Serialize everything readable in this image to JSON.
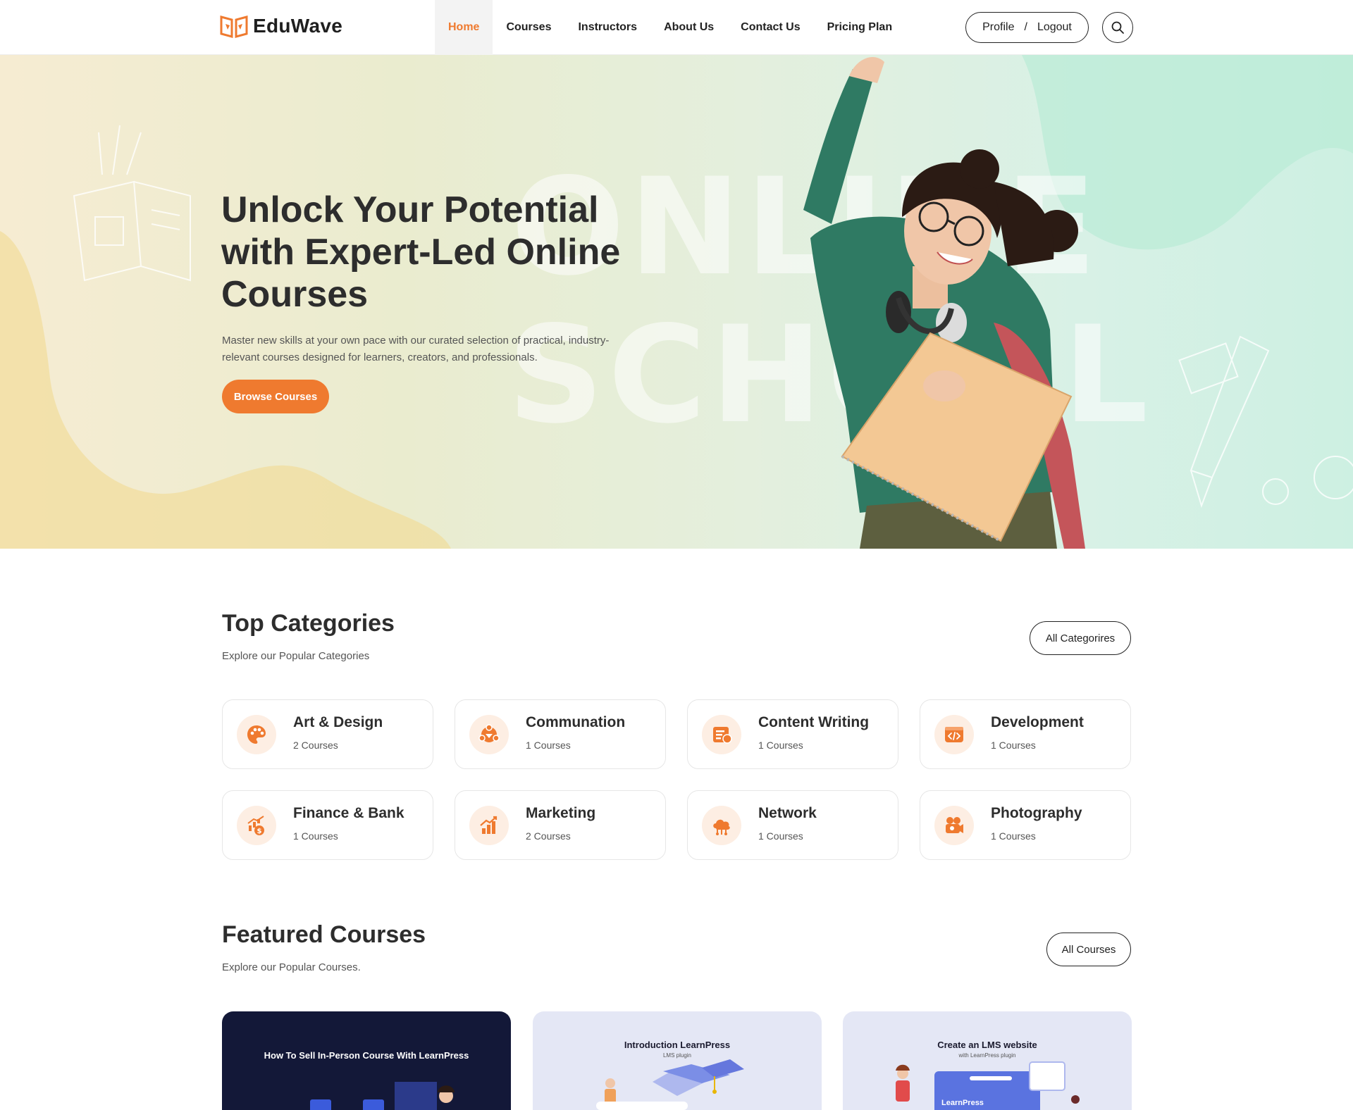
{
  "header": {
    "brand": "EduWave",
    "nav": [
      {
        "label": "Home",
        "active": true
      },
      {
        "label": "Courses",
        "active": false
      },
      {
        "label": "Instructors",
        "active": false
      },
      {
        "label": "About Us",
        "active": false
      },
      {
        "label": "Contact Us",
        "active": false
      },
      {
        "label": "Pricing Plan",
        "active": false
      }
    ],
    "profile_label": "Profile",
    "separator": "/",
    "logout_label": "Logout",
    "search_icon": "search-icon"
  },
  "hero": {
    "title": "Unlock Your Potential with Expert-Led Online Courses",
    "description": "Master new skills at your own pace with our curated selection of practical, industry-relevant courses designed for learners, creators, and professionals.",
    "cta_label": "Browse Courses",
    "watermark_line1": "ONLINE",
    "watermark_line2": "SCHOOL"
  },
  "categories": {
    "title": "Top Categories",
    "subtitle": "Explore our Popular Categories",
    "all_label": "All Categorires",
    "items": [
      {
        "name": "Art & Design",
        "count": "2 Courses",
        "icon": "palette-icon"
      },
      {
        "name": "Communation",
        "count": "1 Courses",
        "icon": "communication-icon"
      },
      {
        "name": "Content Writing",
        "count": "1 Courses",
        "icon": "writing-icon"
      },
      {
        "name": "Development",
        "count": "1 Courses",
        "icon": "code-icon"
      },
      {
        "name": "Finance & Bank",
        "count": "1 Courses",
        "icon": "finance-icon"
      },
      {
        "name": "Marketing",
        "count": "2 Courses",
        "icon": "growth-chart-icon"
      },
      {
        "name": "Network",
        "count": "1 Courses",
        "icon": "cloud-network-icon"
      },
      {
        "name": "Photography",
        "count": "1 Courses",
        "icon": "camera-icon"
      }
    ]
  },
  "featured": {
    "title": "Featured Courses",
    "subtitle": "Explore our Popular Courses.",
    "all_label": "All Courses",
    "courses": [
      {
        "title": "How To Sell In-Person Course With LearnPress",
        "subtitle": ""
      },
      {
        "title": "Introduction LearnPress",
        "subtitle": "LMS plugin"
      },
      {
        "title": "Create an LMS website",
        "subtitle": "with LearnPress plugin",
        "badge": "LearnPress"
      }
    ]
  },
  "colors": {
    "accent": "#ef7a2f",
    "text": "#2d2d2d",
    "hero_left": "#f6ecd2",
    "hero_right": "#cdf0e2"
  }
}
